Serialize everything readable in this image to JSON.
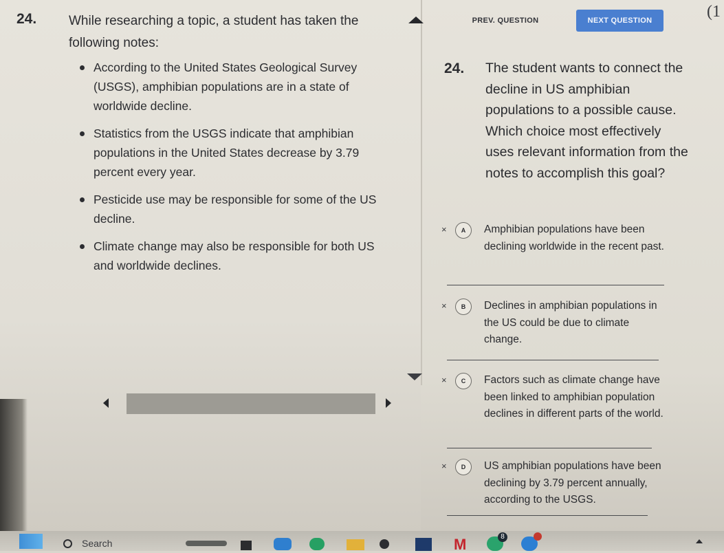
{
  "left": {
    "question_number": "24.",
    "intro": "While researching a topic, a student has taken the following notes:",
    "notes": [
      "According to the United States Geological Survey (USGS), amphibian populations are in a state of worldwide decline.",
      "Statistics from the USGS indicate that amphibian populations in the United States decrease by 3.79 percent every year.",
      "Pesticide use may be responsible for some of the US decline.",
      "Climate change may also be responsible for both US and worldwide declines."
    ]
  },
  "nav": {
    "prev_label": "PREV. QUESTION",
    "next_label": "NEXT QUESTION",
    "corner_text": "(1"
  },
  "right": {
    "question_number": "24.",
    "stem": "The student wants to connect the decline in US amphibian populations to a possible cause. Which choice most effectively uses relevant information from the notes to accomplish this goal?",
    "choices": [
      {
        "letter": "A",
        "mark": "×",
        "text": "Amphibian populations have been declining worldwide in the recent past."
      },
      {
        "letter": "B",
        "mark": "×",
        "text": "Declines in amphibian populations in the US could be due to climate change."
      },
      {
        "letter": "C",
        "mark": "×",
        "text": "Factors such as climate change have been linked to amphibian population declines in different parts of the world."
      },
      {
        "letter": "D",
        "mark": "×",
        "text": "US amphibian populations have been declining by 3.79 percent annually, according to the USGS."
      }
    ]
  },
  "taskbar": {
    "search_label": "Search",
    "badge_count": "8"
  }
}
